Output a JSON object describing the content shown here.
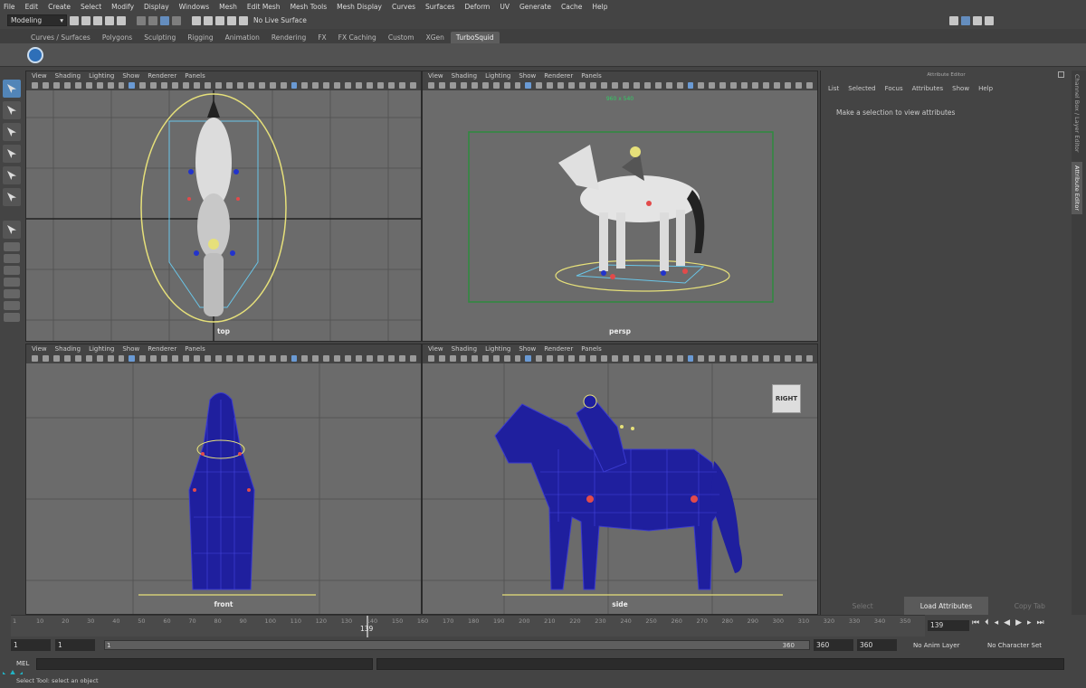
{
  "menubar": [
    "File",
    "Edit",
    "Create",
    "Select",
    "Modify",
    "Display",
    "Windows",
    "Mesh",
    "Edit Mesh",
    "Mesh Tools",
    "Mesh Display",
    "Curves",
    "Surfaces",
    "Deform",
    "UV",
    "Generate",
    "Cache",
    "Help"
  ],
  "status": {
    "mode": "Modeling",
    "live_surface": "No Live Surface"
  },
  "shelf_tabs": [
    "Curves / Surfaces",
    "Polygons",
    "Sculpting",
    "Rigging",
    "Animation",
    "Rendering",
    "FX",
    "FX Caching",
    "Custom",
    "XGen",
    "TurboSquid"
  ],
  "shelf_active": "TurboSquid",
  "viewport_menu": [
    "View",
    "Shading",
    "Lighting",
    "Show",
    "Renderer",
    "Panels"
  ],
  "viewports": {
    "top": {
      "label": "top"
    },
    "persp": {
      "label": "persp",
      "resolution": "960 x 540"
    },
    "front": {
      "label": "front"
    },
    "side": {
      "label": "side",
      "viewcube": "RIGHT"
    }
  },
  "attribute_editor": {
    "title": "Attribute Editor",
    "menu": [
      "List",
      "Selected",
      "Focus",
      "Attributes",
      "Show",
      "Help"
    ],
    "message": "Make a selection to view attributes",
    "buttons": {
      "select": "Select",
      "load": "Load Attributes",
      "copy": "Copy Tab"
    }
  },
  "side_tabs": {
    "channel_box": "Channel Box / Layer Editor",
    "attribute_editor": "Attribute Editor"
  },
  "timeline": {
    "ticks": [
      "1",
      "10",
      "20",
      "30",
      "40",
      "50",
      "60",
      "70",
      "80",
      "90",
      "100",
      "110",
      "120",
      "130",
      "140",
      "150",
      "160",
      "170",
      "180",
      "190",
      "200",
      "210",
      "220",
      "230",
      "240",
      "250",
      "260",
      "270",
      "280",
      "290",
      "300",
      "310",
      "320",
      "330",
      "340",
      "350"
    ],
    "current": "139",
    "current_field": "139"
  },
  "range": {
    "start": "1",
    "playback_start": "1",
    "slider_start": "1",
    "slider_end": "360",
    "playback_end": "360",
    "end": "360",
    "anim_layer": "No Anim Layer",
    "character_set": "No Character Set"
  },
  "command_line": {
    "label": "MEL"
  },
  "help_line": "Select Tool: select an object",
  "colors": {
    "accent": "#5285b8",
    "viewport_bg": "#6b6b6b",
    "wire": "#1f1f9e",
    "gate": "#2e8b3e"
  }
}
